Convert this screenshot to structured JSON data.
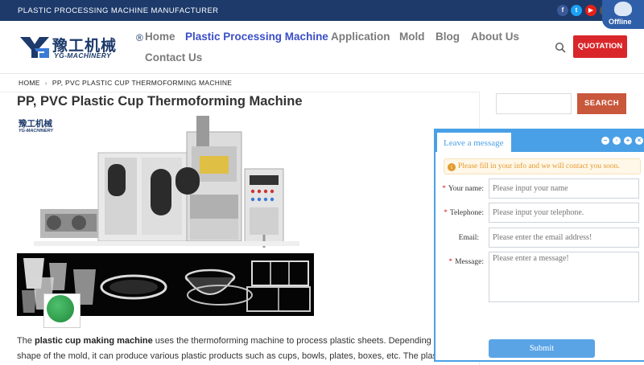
{
  "topbar": {
    "tagline": "PLASTIC PROCESSING MACHINE MANUFACTURER",
    "social": [
      {
        "name": "facebook",
        "glyph": "f",
        "color": "#3b5998"
      },
      {
        "name": "twitter",
        "glyph": "t",
        "color": "#1da1f2"
      },
      {
        "name": "youtube",
        "glyph": "▶",
        "color": "#e62117"
      },
      {
        "name": "instagram",
        "glyph": "◎",
        "color": "#555555"
      }
    ],
    "status": "Offline"
  },
  "logo": {
    "cn": "豫工机械",
    "en": "YG-MACHINERY",
    "reg": "®"
  },
  "nav": [
    {
      "label": "Home",
      "active": false
    },
    {
      "label": "Plastic Processing Machine",
      "active": true
    },
    {
      "label": "Application",
      "active": false
    },
    {
      "label": "Mold",
      "active": false
    },
    {
      "label": "Blog",
      "active": false
    },
    {
      "label": "About Us",
      "active": false
    },
    {
      "label": "Contact Us",
      "active": false
    }
  ],
  "quotation_label": "QUOTATION",
  "breadcrumb": {
    "home": "HOME",
    "separator": "›",
    "current": "PP, PVC PLASTIC CUP THERMOFORMING MACHINE"
  },
  "page_title": "PP, PVC Plastic Cup Thermoforming Machine",
  "product_logo": {
    "cn": "豫工机械",
    "en": "YG-MACHINERY"
  },
  "body": {
    "line1_pre": "The ",
    "line1_bold": "plastic cup making machine",
    "line1_post": " uses the thermoforming machine to process plastic sheets. Depending on",
    "line2": "shape of the mold, it can produce various plastic products such as cups, bowls, plates, boxes, etc. The plas"
  },
  "sidebar": {
    "search_button": "SEARCH"
  },
  "chat": {
    "tab": "Leave a message",
    "notice": "Please fill in your info and we will contact you soon.",
    "fields": [
      {
        "label": "Your name:",
        "required": true,
        "placeholder": "Please input your name"
      },
      {
        "label": "Telephone:",
        "required": true,
        "placeholder": "Please input your telephone."
      },
      {
        "label": "Email:",
        "required": false,
        "placeholder": "Please enter the email address!"
      },
      {
        "label": "Message:",
        "required": true,
        "placeholder": "Please enter a message!"
      }
    ],
    "submit": "Submit"
  },
  "colors": {
    "navy": "#1d3a6b",
    "accent_nav": "#3a4fc7",
    "quotation": "#d9262a",
    "chat": "#4aa0e6"
  }
}
